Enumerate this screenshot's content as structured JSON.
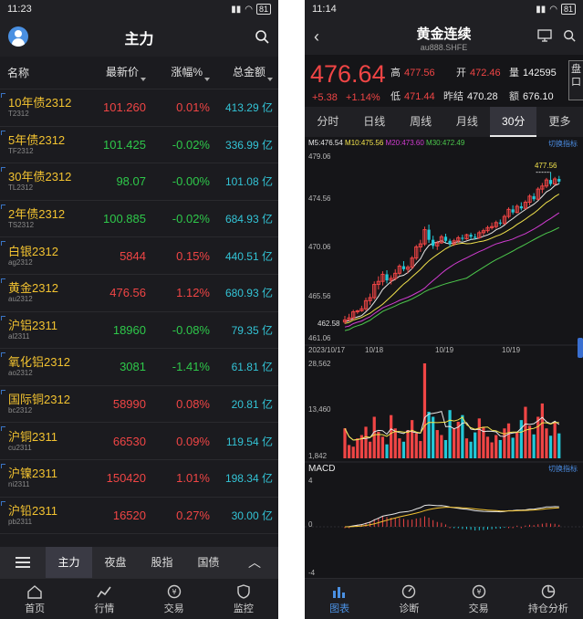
{
  "left": {
    "status": {
      "time": "11:23",
      "battery": "81"
    },
    "title": "主力",
    "columns": {
      "name": "名称",
      "price": "最新价",
      "change": "涨幅%",
      "amount": "总金额"
    },
    "rows": [
      {
        "name": "10年债2312",
        "code": "T2312",
        "price": "101.260",
        "change": "0.01%",
        "amount": "413.29 亿",
        "dir": "up"
      },
      {
        "name": "5年债2312",
        "code": "TF2312",
        "price": "101.425",
        "change": "-0.02%",
        "amount": "336.99 亿",
        "dir": "down"
      },
      {
        "name": "30年债2312",
        "code": "TL2312",
        "price": "98.07",
        "change": "-0.00%",
        "amount": "101.08 亿",
        "dir": "down"
      },
      {
        "name": "2年债2312",
        "code": "TS2312",
        "price": "100.885",
        "change": "-0.02%",
        "amount": "684.93 亿",
        "dir": "down"
      },
      {
        "name": "白银2312",
        "code": "ag2312",
        "price": "5844",
        "change": "0.15%",
        "amount": "440.51 亿",
        "dir": "up"
      },
      {
        "name": "黄金2312",
        "code": "au2312",
        "price": "476.56",
        "change": "1.12%",
        "amount": "680.93 亿",
        "dir": "up"
      },
      {
        "name": "沪铝2311",
        "code": "al2311",
        "price": "18960",
        "change": "-0.08%",
        "amount": "79.35 亿",
        "dir": "down"
      },
      {
        "name": "氧化铝2312",
        "code": "ao2312",
        "price": "3081",
        "change": "-1.41%",
        "amount": "61.81 亿",
        "dir": "down"
      },
      {
        "name": "国际铜2312",
        "code": "bc2312",
        "price": "58990",
        "change": "0.08%",
        "amount": "20.81 亿",
        "dir": "up"
      },
      {
        "name": "沪铜2311",
        "code": "cu2311",
        "price": "66530",
        "change": "0.09%",
        "amount": "119.54 亿",
        "dir": "up"
      },
      {
        "name": "沪镍2311",
        "code": "ni2311",
        "price": "150420",
        "change": "1.01%",
        "amount": "198.34 亿",
        "dir": "up"
      },
      {
        "name": "沪铅2311",
        "code": "pb2311",
        "price": "16520",
        "change": "0.27%",
        "amount": "30.00 亿",
        "dir": "up"
      }
    ],
    "tabs": [
      "主力",
      "夜盘",
      "股指",
      "国债"
    ],
    "nav": [
      "首页",
      "行情",
      "交易",
      "监控"
    ]
  },
  "right": {
    "status": {
      "time": "11:14",
      "battery": "81"
    },
    "title": "黄金连续",
    "subtitle": "au888.SHFE",
    "price": "476.64",
    "change": "+5.38",
    "change_pct": "+1.14%",
    "quote": {
      "high_label": "高",
      "high": "477.56",
      "open_label": "开",
      "open": "472.46",
      "vol_label": "量",
      "vol": "142595",
      "low_label": "低",
      "low": "471.44",
      "prev_label": "昨结",
      "prev": "470.28",
      "amt_label": "额",
      "amt": "676.10"
    },
    "side_button": "盘口",
    "period_tabs": [
      "分时",
      "日线",
      "周线",
      "月线",
      "30分",
      "更多"
    ],
    "ma_labels": {
      "ma5": "M5:476.54",
      "ma10": "M10:475.56",
      "ma20": "M20:473.60",
      "ma30": "M30:472.49"
    },
    "switch_indicator": "切换指标",
    "price_axis": [
      "479.06",
      "474.56",
      "470.06",
      "465.56",
      "461.06"
    ],
    "high_mark": "477.56",
    "low_mark": "462.58",
    "dates": [
      "2023/10/17",
      "10/18",
      "10/19",
      "10/19"
    ],
    "volume_axis": [
      "28,562",
      "13,460",
      "1,842"
    ],
    "macd_label": "MACD",
    "macd_axis": [
      "4",
      "0",
      "-4"
    ],
    "nav": [
      "图表",
      "诊断",
      "交易",
      "持仓分析"
    ],
    "colors": {
      "up": "#f04545",
      "down": "#22c8d8",
      "ma5": "#e8e8e8",
      "ma10": "#f2e34c",
      "ma20": "#d23cd2",
      "ma30": "#4cc84c"
    }
  },
  "chart_data": {
    "type": "candlestick",
    "title": "黄金连续",
    "ylim": [
      461.06,
      479.06
    ],
    "candles": [
      [
        462.8,
        463.4,
        462.6,
        463.0
      ],
      [
        463.0,
        463.6,
        462.9,
        463.2
      ],
      [
        463.2,
        464.0,
        463.0,
        463.8
      ],
      [
        463.8,
        464.0,
        463.6,
        463.9
      ],
      [
        463.9,
        464.4,
        463.8,
        464.1
      ],
      [
        464.1,
        465.2,
        463.9,
        464.9
      ],
      [
        464.9,
        465.6,
        464.5,
        465.2
      ],
      [
        465.2,
        466.8,
        465.0,
        466.5
      ],
      [
        466.5,
        467.3,
        466.0,
        466.8
      ],
      [
        466.8,
        467.8,
        466.4,
        467.5
      ],
      [
        467.5,
        467.9,
        466.6,
        466.9
      ],
      [
        466.9,
        467.4,
        466.5,
        467.1
      ],
      [
        467.1,
        468.0,
        466.9,
        467.6
      ],
      [
        467.6,
        468.5,
        467.4,
        468.3
      ],
      [
        468.3,
        468.8,
        467.8,
        468.0
      ],
      [
        468.0,
        468.4,
        467.6,
        468.2
      ],
      [
        468.2,
        469.3,
        468.0,
        469.1
      ],
      [
        469.1,
        470.4,
        468.9,
        470.2
      ],
      [
        470.2,
        470.9,
        469.7,
        470.5
      ],
      [
        470.5,
        472.2,
        470.3,
        471.9
      ],
      [
        471.9,
        472.4,
        470.6,
        470.9
      ],
      [
        470.9,
        471.3,
        470.0,
        470.3
      ],
      [
        470.3,
        470.8,
        469.9,
        470.6
      ],
      [
        470.6,
        471.4,
        470.5,
        471.2
      ],
      [
        471.2,
        471.5,
        470.6,
        470.8
      ],
      [
        470.8,
        471.0,
        470.2,
        470.5
      ],
      [
        470.5,
        471.0,
        470.3,
        470.8
      ],
      [
        470.8,
        471.3,
        470.6,
        471.1
      ],
      [
        471.1,
        471.4,
        470.8,
        471.0
      ],
      [
        471.0,
        471.5,
        470.9,
        471.4
      ],
      [
        471.4,
        471.6,
        470.9,
        471.2
      ],
      [
        471.2,
        471.5,
        470.9,
        471.1
      ],
      [
        471.1,
        471.8,
        471.0,
        471.6
      ],
      [
        471.6,
        472.0,
        471.3,
        471.8
      ],
      [
        471.8,
        472.3,
        471.6,
        472.1
      ],
      [
        472.1,
        472.6,
        471.9,
        472.2
      ],
      [
        472.2,
        472.8,
        472.0,
        472.6
      ],
      [
        472.6,
        472.9,
        472.3,
        472.5
      ],
      [
        472.5,
        473.4,
        472.4,
        473.2
      ],
      [
        473.2,
        474.1,
        473.0,
        473.9
      ],
      [
        473.9,
        474.3,
        473.4,
        473.6
      ],
      [
        473.6,
        474.4,
        473.5,
        474.2
      ],
      [
        474.2,
        474.6,
        473.8,
        474.0
      ],
      [
        474.0,
        474.8,
        473.9,
        474.6
      ],
      [
        474.6,
        475.4,
        474.3,
        475.2
      ],
      [
        475.2,
        475.5,
        474.7,
        474.9
      ],
      [
        474.9,
        476.1,
        474.8,
        475.9
      ],
      [
        475.9,
        476.5,
        475.5,
        476.2
      ],
      [
        476.2,
        477.0,
        476.0,
        476.8
      ],
      [
        476.8,
        477.56,
        476.2,
        476.4
      ],
      [
        476.4,
        477.1,
        476.3,
        476.9
      ],
      [
        476.9,
        477.2,
        476.4,
        476.64
      ]
    ],
    "volume": [
      9000,
      4000,
      3500,
      6000,
      7000,
      9500,
      5000,
      12500,
      8000,
      6500,
      4200,
      13000,
      9000,
      6000,
      5000,
      8500,
      11500,
      7500,
      5200,
      28562,
      14000,
      12500,
      8500,
      7000,
      5500,
      14500,
      9000,
      11000,
      13000,
      6000,
      5000,
      7800,
      12000,
      9500,
      6500,
      4800,
      7000,
      5500,
      9000,
      10500,
      6200,
      8000,
      11500,
      15500,
      9800,
      7200,
      12500,
      16500,
      9000,
      6800,
      11000,
      7500
    ],
    "macd_range": [
      -4,
      4
    ]
  }
}
